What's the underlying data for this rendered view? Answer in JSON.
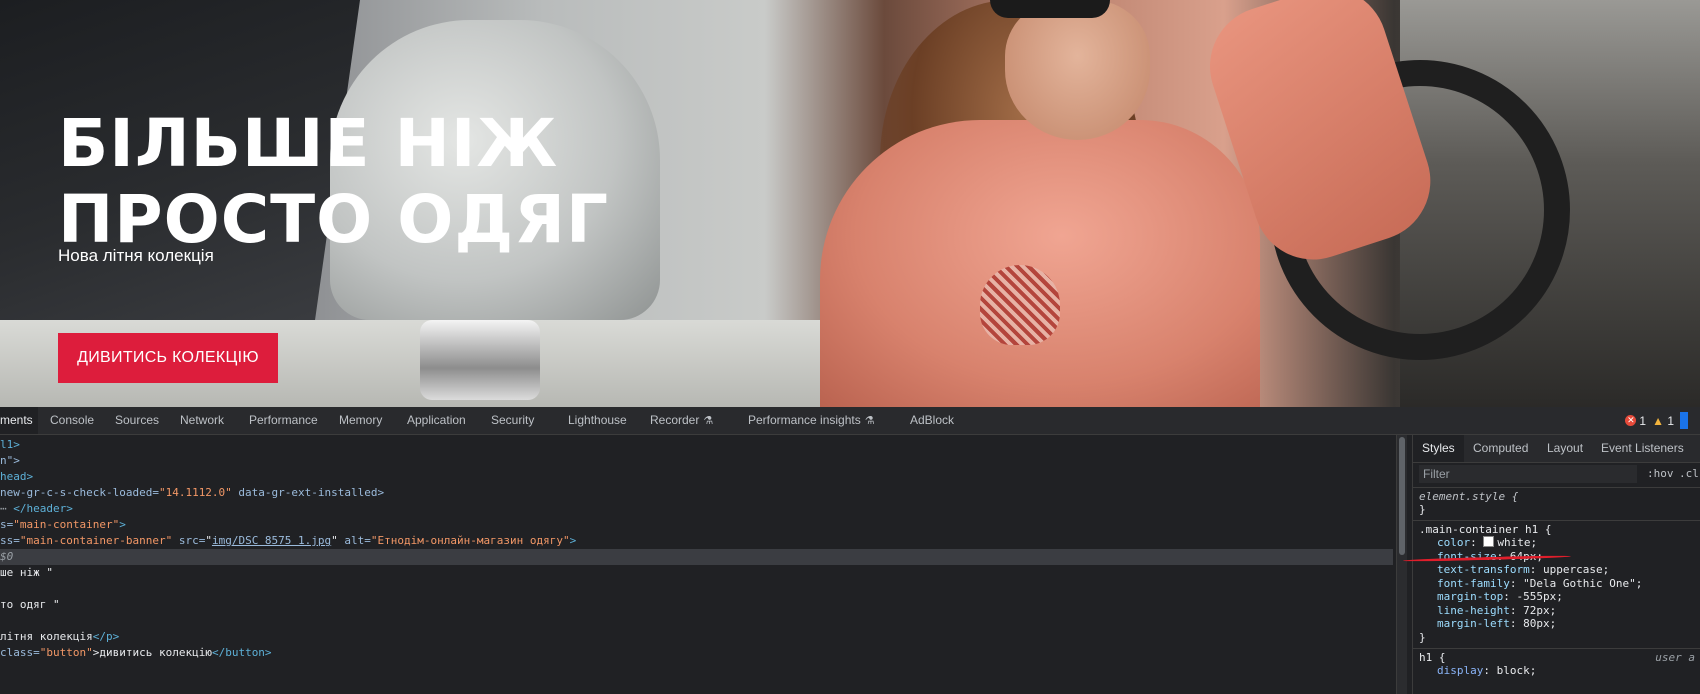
{
  "hero": {
    "title_line1": "Більше ніж",
    "title_line2": "просто одяг",
    "subtitle": "Нова літня колекція",
    "cta_label": "ДИВИТИСЬ КОЛЕКЦІЮ",
    "accent_color": "#dd1d3c"
  },
  "devtools": {
    "tabs": [
      "ments",
      "Console",
      "Sources",
      "Network",
      "Performance",
      "Memory",
      "Application",
      "Security",
      "Lighthouse",
      "Recorder",
      "Performance insights",
      "AdBlock"
    ],
    "error_count": "1",
    "warning_count": "1",
    "elements_lines": {
      "l0": "l1>",
      "l1a": "n\">",
      "l2": "head>",
      "l3a": "new-gr-c-s-check-loaded=",
      "l3b": "\"14.1112.0\"",
      "l3c": " data-gr-ext-installed>",
      "l4a": "</header>",
      "l5a": "s=",
      "l5b": "\"main-container\"",
      "l5c": ">",
      "l6a": "ss=",
      "l6b": "\"main-container-banner\"",
      "l6c": " src=",
      "l6d": "img/DSC 8575 1.jpg",
      "l6e": " alt=",
      "l6f": "\"Етнодім-онлайн-магазин одягу\"",
      "l6g": ">",
      "l7": "$0",
      "l8": "ше ніж \"",
      "l9": "то одяг \"",
      "l10a": "літня колекція",
      "l10b": "</p>",
      "l11a": "class=",
      "l11b": "\"button\"",
      "l11c": ">дивитись колекцію",
      "l11d": "</button>"
    },
    "styles": {
      "subtabs": [
        "Styles",
        "Computed",
        "Layout",
        "Event Listeners"
      ],
      "filter_placeholder": "Filter",
      "hov": ":hov",
      "cls": ".cl",
      "element_style": "element.style {",
      "close_brace": "}",
      "main_selector": ".main-container h1 {",
      "decls": [
        {
          "p": "color",
          "v": "white;"
        },
        {
          "p": "font-size",
          "v": "64px;"
        },
        {
          "p": "text-transform",
          "v": "uppercase;"
        },
        {
          "p": "font-family",
          "v": "\"Dela Gothic One\";"
        },
        {
          "p": "margin-top",
          "v": "-555px;"
        },
        {
          "p": "line-height",
          "v": "72px;"
        },
        {
          "p": "margin-left",
          "v": "80px;"
        }
      ],
      "h1_selector": "h1 {",
      "h1_origin": "user a",
      "h1_decl_p": "display",
      "h1_decl_v": "block;"
    }
  }
}
